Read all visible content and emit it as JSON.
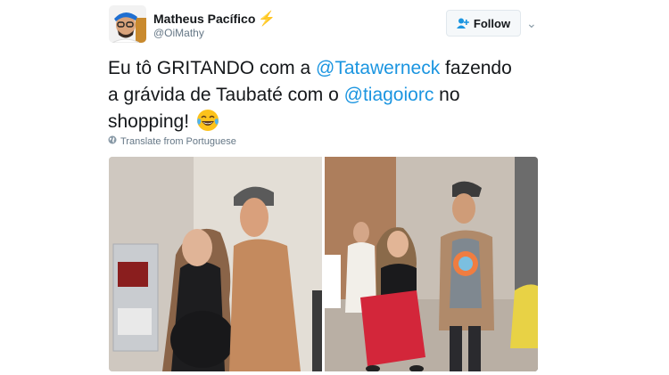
{
  "author": {
    "name": "Matheus Pacífico",
    "handle": "@OiMathy",
    "badge": "⚡"
  },
  "header": {
    "follow_label": "Follow",
    "chevron": "⌄"
  },
  "tweet": {
    "seg1": "Eu tô GRITANDO com a ",
    "mention1": "@Tatawerneck",
    "seg2": " fazendo a grávida de Taubaté com o ",
    "mention2": "@tiagoiorc",
    "seg3": " no shopping! ",
    "emoji_name": "face-with-tears-of-joy"
  },
  "translate": {
    "label": "Translate from Portuguese"
  },
  "colors": {
    "link": "#1b95e0",
    "text": "#14171a",
    "muted": "#657786",
    "stroller_red": "#d3263a"
  }
}
